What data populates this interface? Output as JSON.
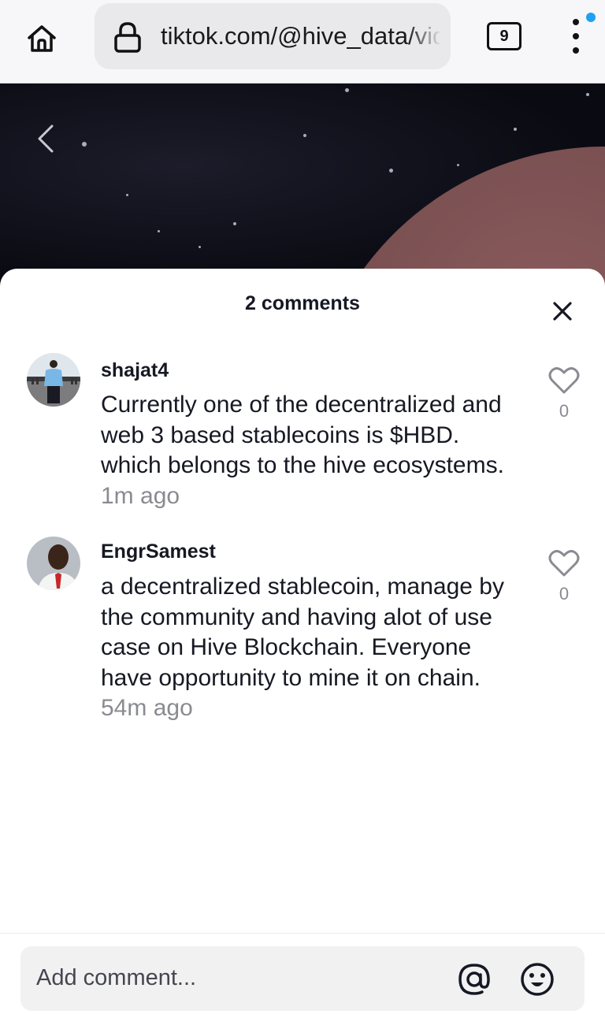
{
  "browser": {
    "url": "tiktok.com/@hive_data/video",
    "tab_count": "9"
  },
  "comments_sheet": {
    "title": "2 comments",
    "comments": [
      {
        "username": "shajat4",
        "text": "Currently one of the decentralized and web 3 based stablecoins is $HBD. which belongs to the hive ecosystems.",
        "time": "1m ago",
        "likes": "0"
      },
      {
        "username": "EngrSamest",
        "text": "a decentralized stablecoin, manage by the community and having alot of use case on Hive Blockchain. Everyone have opportunity to mine it on chain.",
        "time": "54m ago",
        "likes": "0"
      }
    ],
    "input_placeholder": "Add comment..."
  },
  "colors": {
    "accent_blue": "#1ea1f2",
    "text_primary": "#161823",
    "text_secondary": "#8a8b91"
  }
}
